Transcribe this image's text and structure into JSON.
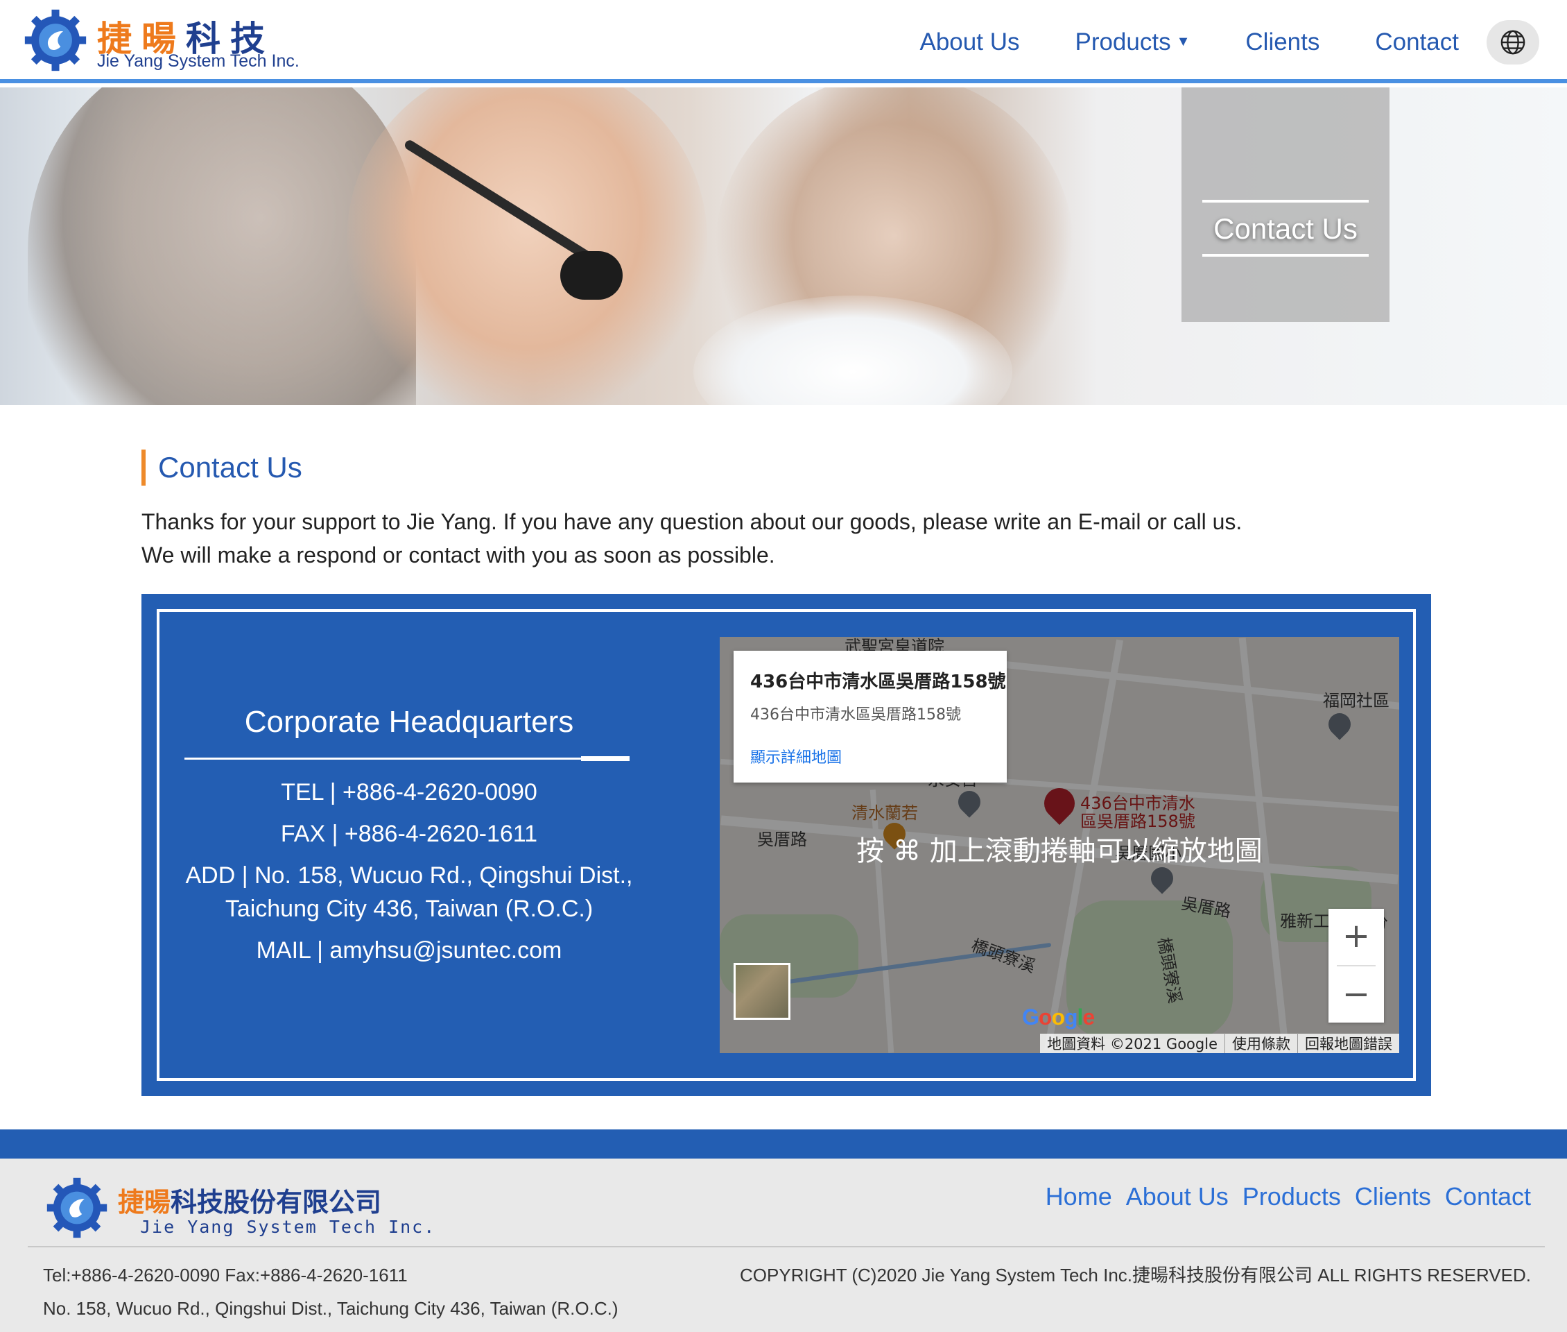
{
  "brand": {
    "name_zh_orange": "捷暘",
    "name_zh_blue": "科技",
    "name_en": "Jie Yang System Tech Inc.",
    "primary_color": "#2559b0",
    "accent_color": "#ee7a1c",
    "band_color": "#235eb3"
  },
  "nav": {
    "items": [
      "About Us",
      "Products",
      "Clients",
      "Contact"
    ],
    "products_caret": "▼",
    "language_icon": "globe-icon"
  },
  "hero": {
    "title": "Contact Us"
  },
  "content": {
    "section_title": "Contact Us",
    "intro_line1": "Thanks for your support to Jie Yang. If you have any question about our goods, please write an E-mail or call us.",
    "intro_line2": "We will make a respond or contact with you as soon as possible."
  },
  "hq": {
    "title": "Corporate Headquarters",
    "tel": "TEL | +886-4-2620-0090",
    "fax": "FAX | +886-4-2620-1611",
    "add_line1": "ADD | No. 158, Wucuo Rd., Qingshui Dist.,",
    "add_line2": "Taichung City 436, Taiwan (R.O.C.)",
    "mail": "MAIL | amyhsu@jsuntec.com"
  },
  "map": {
    "card_title": "436台中市清水區吳厝路158號",
    "card_address": "436台中市清水區吳厝路158號",
    "card_link": "顯示詳細地圖",
    "scroll_message": "按 ⌘ 加上滾動捲軸可以縮放地圖",
    "labels": {
      "top": "武聖宮皇道院",
      "fugang": "福岡社區",
      "qingshui_lanruo": "清水蘭若",
      "wucuo_road_left": "吳厝路",
      "wucuo_road_right": "吳厝路",
      "yaxin": "雅新工",
      "pin_label_1": "436台中市清水",
      "pin_label_2": "區吳厝路158號",
      "river_1": "橋頭寮溪",
      "river_2": "橋頭寮溪",
      "partial_top": "永安宮",
      "partial_mid": "吳厝國小",
      "partial_right": "分"
    },
    "zoom_in": "+",
    "zoom_out": "−",
    "google_logo": "Google",
    "attribution": [
      "地圖資料 ©2021 Google",
      "使用條款",
      "回報地圖錯誤"
    ]
  },
  "footer": {
    "company_zh_orange": "捷暘",
    "company_zh_blue": "科技股份有限公司",
    "company_en": "Jie Yang System Tech Inc.",
    "nav": [
      "Home",
      "About Us",
      "Products",
      "Clients",
      "Contact"
    ],
    "contact_line": "Tel:+886-4-2620-0090 Fax:+886-4-2620-1611",
    "address_line": "No. 158, Wucuo Rd., Qingshui Dist., Taichung City 436, Taiwan (R.O.C.)",
    "copyright": "COPYRIGHT (C)2020 Jie Yang System Tech Inc.捷暘科技股份有限公司 ALL RIGHTS RESERVED."
  }
}
